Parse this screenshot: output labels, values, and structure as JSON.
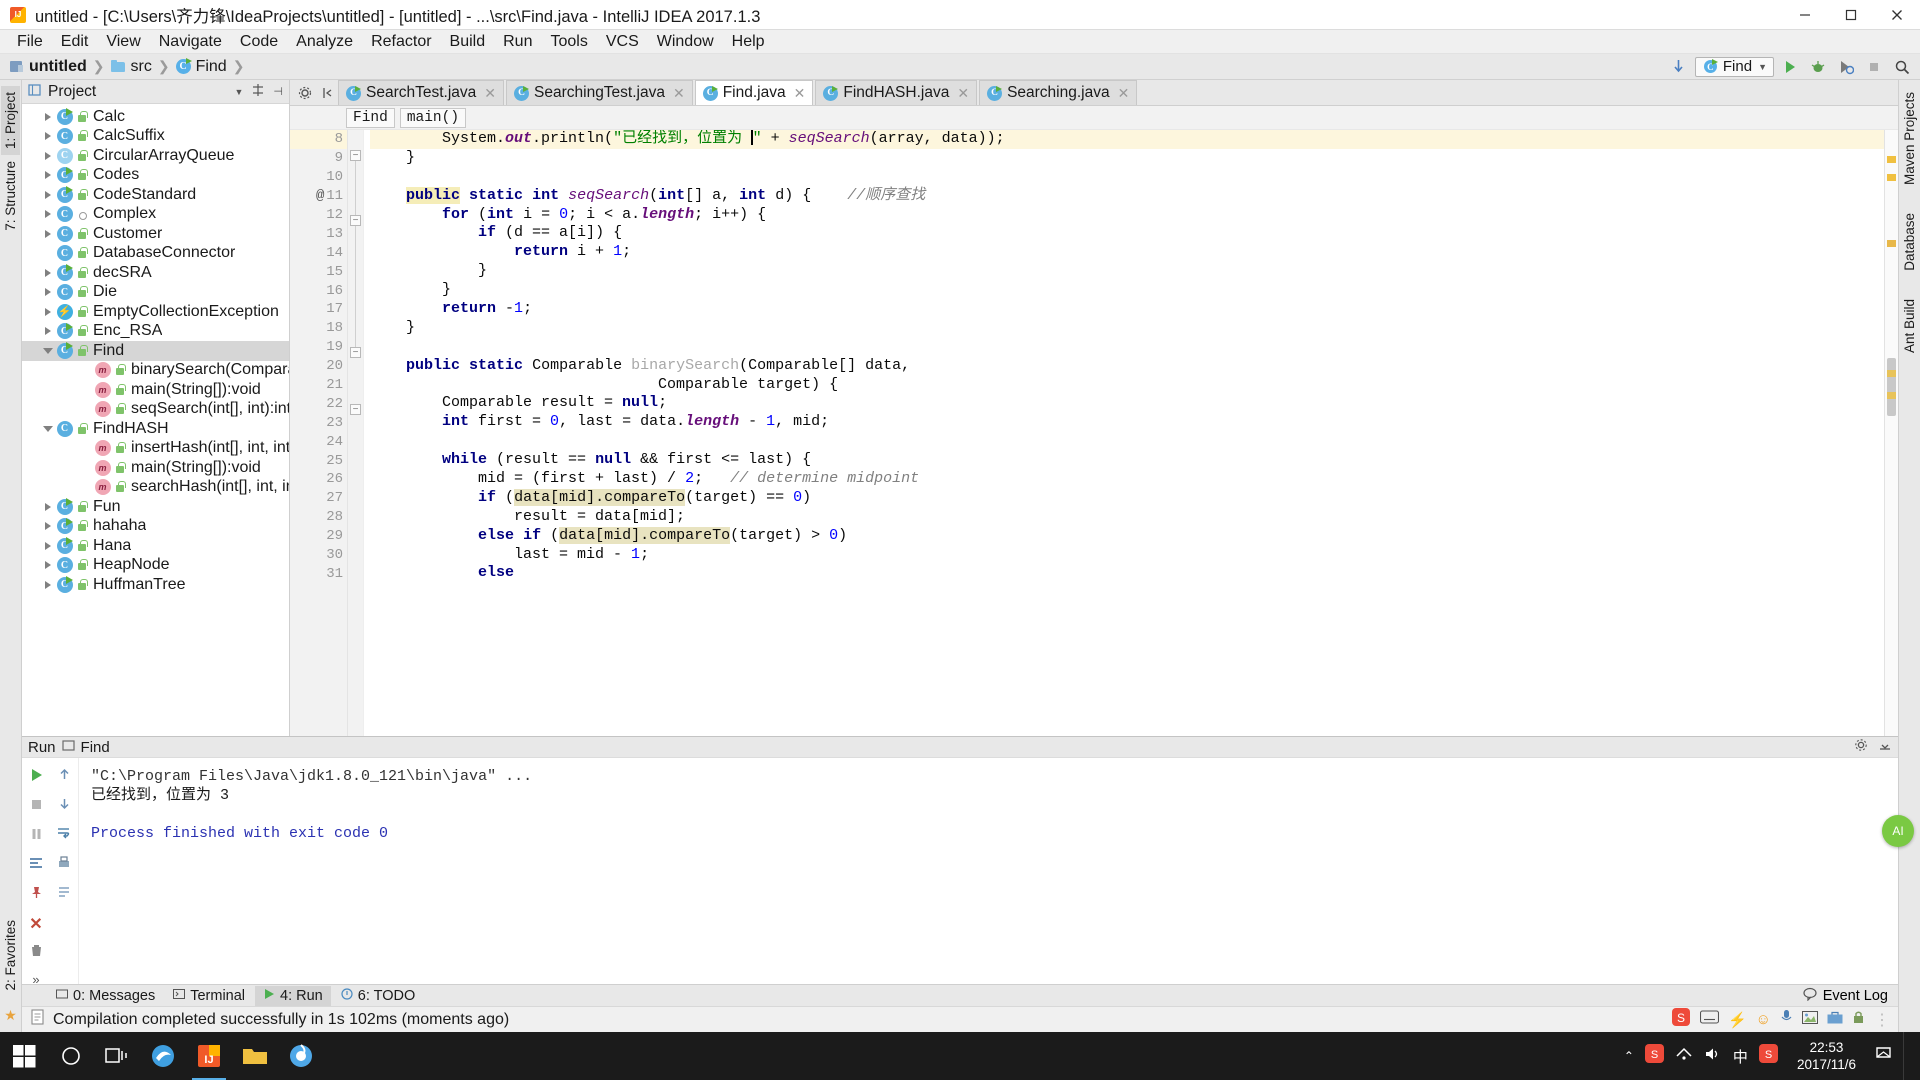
{
  "window": {
    "title": "untitled - [C:\\Users\\齐力锋\\IdeaProjects\\untitled] - [untitled] - ...\\src\\Find.java - IntelliJ IDEA 2017.1.3",
    "icon": "intellij-idea-icon",
    "minimize": "–",
    "maximize": "□",
    "close": "✕"
  },
  "menu": [
    "File",
    "Edit",
    "View",
    "Navigate",
    "Code",
    "Analyze",
    "Refactor",
    "Build",
    "Run",
    "Tools",
    "VCS",
    "Window",
    "Help"
  ],
  "navbar": {
    "breadcrumbs": [
      {
        "label": "untitled",
        "icon": "module-icon",
        "bold": true
      },
      {
        "label": "src",
        "icon": "folder-icon",
        "bold": false
      },
      {
        "label": "Find",
        "icon": "java-class-icon",
        "bold": false
      }
    ],
    "run_config": "Find",
    "buttons": [
      "run-button",
      "debug-button",
      "coverage-button",
      "stop-button",
      "search-everywhere-button"
    ]
  },
  "left_strip": [
    {
      "label": "1: Project",
      "selected": true
    },
    {
      "label": "7: Structure",
      "selected": false
    },
    {
      "label": "2: Favorites",
      "selected": false
    }
  ],
  "right_strip": [
    "Maven Projects",
    "Database",
    "Ant Build"
  ],
  "project_panel": {
    "title": "Project",
    "tree": [
      {
        "label": "Calc",
        "icon": "class-run",
        "depth": 1,
        "arrow": "closed",
        "vis": "lock"
      },
      {
        "label": "CalcSuffix",
        "icon": "class",
        "depth": 1,
        "arrow": "closed",
        "vis": "lock"
      },
      {
        "label": "CircularArrayQueue",
        "icon": "class-light",
        "depth": 1,
        "arrow": "closed",
        "vis": "lock"
      },
      {
        "label": "Codes",
        "icon": "class-run",
        "depth": 1,
        "arrow": "closed",
        "vis": "lock"
      },
      {
        "label": "CodeStandard",
        "icon": "class-run",
        "depth": 1,
        "arrow": "closed",
        "vis": "lock"
      },
      {
        "label": "Complex",
        "icon": "class",
        "depth": 1,
        "arrow": "closed",
        "vis": "pkg"
      },
      {
        "label": "Customer",
        "icon": "class",
        "depth": 1,
        "arrow": "closed",
        "vis": "lock"
      },
      {
        "label": "DatabaseConnector",
        "icon": "class",
        "depth": 1,
        "arrow": "none",
        "vis": "lock"
      },
      {
        "label": "decSRA",
        "icon": "class-run",
        "depth": 1,
        "arrow": "closed",
        "vis": "lock"
      },
      {
        "label": "Die",
        "icon": "class",
        "depth": 1,
        "arrow": "closed",
        "vis": "lock"
      },
      {
        "label": "EmptyCollectionException",
        "icon": "exception",
        "depth": 1,
        "arrow": "closed",
        "vis": "lock"
      },
      {
        "label": "Enc_RSA",
        "icon": "class-run",
        "depth": 1,
        "arrow": "closed",
        "vis": "lock"
      },
      {
        "label": "Find",
        "icon": "class-run",
        "depth": 1,
        "arrow": "open",
        "vis": "lock",
        "selected": true
      },
      {
        "label": "binarySearch(Comparable",
        "icon": "method",
        "depth": 2,
        "arrow": "none",
        "vis": "lock"
      },
      {
        "label": "main(String[]):void",
        "icon": "method",
        "depth": 2,
        "arrow": "none",
        "vis": "lock"
      },
      {
        "label": "seqSearch(int[], int):int",
        "icon": "method",
        "depth": 2,
        "arrow": "none",
        "vis": "lock"
      },
      {
        "label": "FindHASH",
        "icon": "class",
        "depth": 1,
        "arrow": "open",
        "vis": "lock"
      },
      {
        "label": "insertHash(int[], int, int):v",
        "icon": "method",
        "depth": 2,
        "arrow": "none",
        "vis": "lock"
      },
      {
        "label": "main(String[]):void",
        "icon": "method",
        "depth": 2,
        "arrow": "none",
        "vis": "lock"
      },
      {
        "label": "searchHash(int[], int, int):i",
        "icon": "method",
        "depth": 2,
        "arrow": "none",
        "vis": "lock"
      },
      {
        "label": "Fun",
        "icon": "class-run",
        "depth": 1,
        "arrow": "closed",
        "vis": "lock"
      },
      {
        "label": "hahaha",
        "icon": "class-run",
        "depth": 1,
        "arrow": "closed",
        "vis": "lock"
      },
      {
        "label": "Hana",
        "icon": "class-run",
        "depth": 1,
        "arrow": "closed",
        "vis": "lock"
      },
      {
        "label": "HeapNode",
        "icon": "class",
        "depth": 1,
        "arrow": "closed",
        "vis": "lock"
      },
      {
        "label": "HuffmanTree",
        "icon": "class-run",
        "depth": 1,
        "arrow": "closed",
        "vis": "lock"
      }
    ]
  },
  "editor": {
    "tabs": [
      {
        "label": "SearchTest.java",
        "active": false
      },
      {
        "label": "SearchingTest.java",
        "active": false
      },
      {
        "label": "Find.java",
        "active": true
      },
      {
        "label": "FindHASH.java",
        "active": false
      },
      {
        "label": "Searching.java",
        "active": false
      }
    ],
    "breadcrumb": [
      "Find",
      "main()"
    ],
    "first_line_number": 8,
    "lines": [
      {
        "n": 8,
        "highlight": true
      },
      {
        "n": 9,
        "highlight": false
      },
      {
        "n": 10,
        "highlight": false
      },
      {
        "n": 11,
        "highlight": false,
        "gutter_at": "@"
      },
      {
        "n": 12,
        "highlight": false
      },
      {
        "n": 13,
        "highlight": false
      },
      {
        "n": 14,
        "highlight": false
      },
      {
        "n": 15,
        "highlight": false
      },
      {
        "n": 16,
        "highlight": false
      },
      {
        "n": 17,
        "highlight": false
      },
      {
        "n": 18,
        "highlight": false
      },
      {
        "n": 19,
        "highlight": false
      },
      {
        "n": 20,
        "highlight": false
      },
      {
        "n": 21,
        "highlight": false
      },
      {
        "n": 22,
        "highlight": false
      },
      {
        "n": 23,
        "highlight": false
      },
      {
        "n": 24,
        "highlight": false
      },
      {
        "n": 25,
        "highlight": false
      },
      {
        "n": 26,
        "highlight": false
      },
      {
        "n": 27,
        "highlight": false
      },
      {
        "n": 28,
        "highlight": false
      },
      {
        "n": 29,
        "highlight": false
      },
      {
        "n": 30,
        "highlight": false
      },
      {
        "n": 31,
        "highlight": false
      }
    ],
    "source_text": [
      "        System.out.println(\"已经找到，位置为 \" + seqSearch(array, data));",
      "    }",
      "",
      "    public static int seqSearch(int[] a, int d) {    //顺序查找",
      "        for (int i = 0; i < a.length; i++) {",
      "            if (d == a[i]) {",
      "                return i + 1;",
      "            }",
      "        }",
      "        return -1;",
      "    }",
      "",
      "    public static Comparable binarySearch(Comparable[] data,",
      "                                Comparable target) {",
      "        Comparable result = null;",
      "        int first = 0, last = data.length - 1, mid;",
      "",
      "        while (result == null && first <= last) {",
      "            mid = (first + last) / 2;   // determine midpoint",
      "            if (data[mid].compareTo(target) == 0)",
      "                result = data[mid];",
      "            else if (data[mid].compareTo(target) > 0)",
      "                last = mid - 1;",
      "            else"
    ]
  },
  "run_panel": {
    "tab_label": "Run",
    "config_label": "Find",
    "console": [
      {
        "text": "\"C:\\Program Files\\Java\\jdk1.8.0_121\\bin\\java\" ...",
        "kind": "cmd"
      },
      {
        "text": "已经找到，位置为 3",
        "kind": "out"
      },
      {
        "text": "",
        "kind": "out"
      },
      {
        "text": "Process finished with exit code 0",
        "kind": "fin"
      }
    ],
    "tool_buttons": [
      "rerun-button",
      "up-button",
      "down-button",
      "pause-button",
      "soft-wrap-button",
      "print-button",
      "scroll-to-end-button",
      "pin-button",
      "close-button",
      "delete-button",
      "expand-button"
    ]
  },
  "bottom_tabs": [
    {
      "label": "0: Messages",
      "icon": "messages-icon",
      "selected": false
    },
    {
      "label": "Terminal",
      "icon": "terminal-icon",
      "selected": false
    },
    {
      "label": "4: Run",
      "icon": "run-icon",
      "selected": true
    },
    {
      "label": "6: TODO",
      "icon": "todo-icon",
      "selected": false
    }
  ],
  "bottom_right": {
    "event_log": "Event Log",
    "icon": "balloon-icon"
  },
  "status_bar": {
    "message": "Compilation completed successfully in 1s 102ms (moments ago)",
    "icon": "document-icon"
  },
  "taskbar": {
    "start": "windows-start-icon",
    "items": [
      "cortana-search-icon",
      "task-view-icon",
      "edge-icon",
      "intellij-icon",
      "explorer-icon",
      "browser-icon"
    ],
    "tray_icons": [
      "chevron-up-icon",
      "sogou-icon",
      "network-icon",
      "volume-icon",
      "ime-cn-icon",
      "sogou-pinyin-icon"
    ],
    "ime_label": "中",
    "clock_time": "22:53",
    "clock_date": "2017/11/6"
  },
  "colors": {
    "accent": "#57b0e8",
    "keyword": "#000080",
    "string": "#008000",
    "comment": "#808080",
    "field": "#660e7a",
    "number": "#0000ff",
    "highlight_line": "#fdf6dd",
    "taskbar_bg": "#1b1b1b"
  }
}
